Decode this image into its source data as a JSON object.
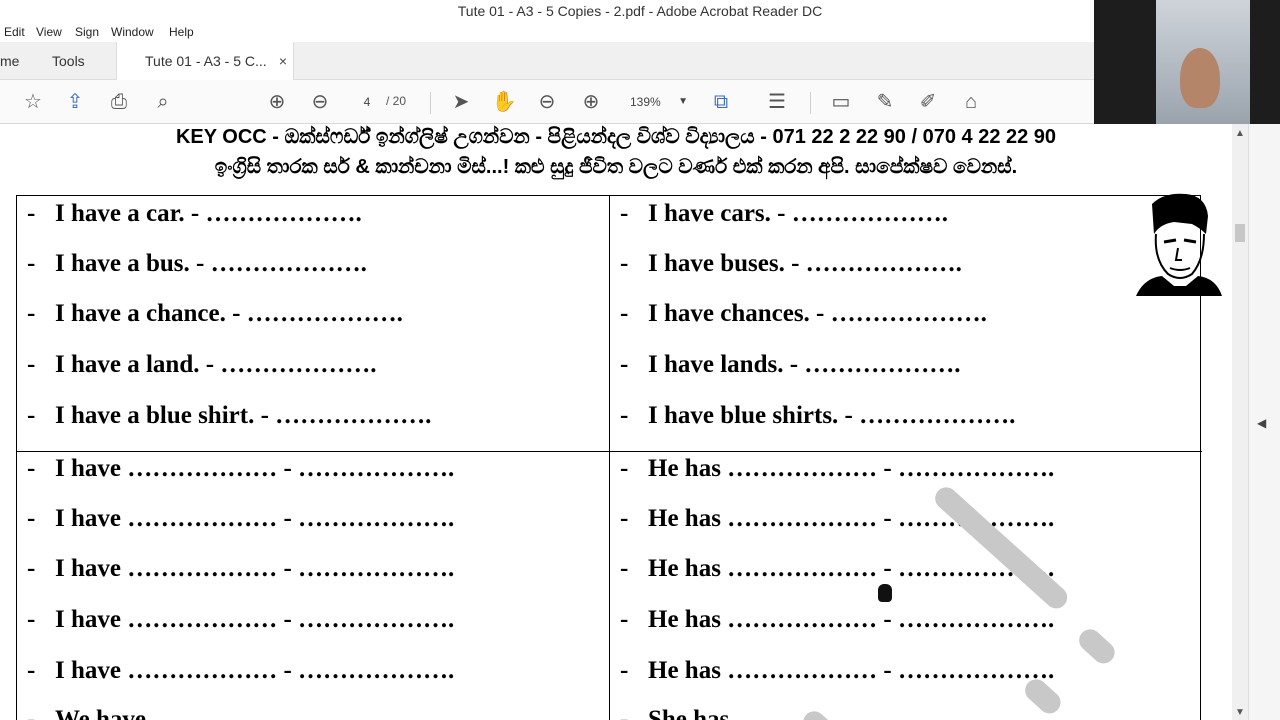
{
  "window": {
    "title": "Tute 01 - A3 - 5 Copies - 2.pdf - Adobe Acrobat Reader DC"
  },
  "menu": {
    "items": [
      "Edit",
      "View",
      "Sign",
      "Window",
      "Help"
    ]
  },
  "tabs": {
    "home": "me",
    "tools": "Tools",
    "doc": "Tute 01 - A3 - 5 C...",
    "close": "×"
  },
  "toolbar": {
    "page_current": "4",
    "page_total": "/ 20",
    "zoom": "139%"
  },
  "document": {
    "header1": "KEY OCC - ඔක්ස්ෆර්ඩ් ඉන්ග්ලිෂ් උගන්වන - පිළියන්දල විශ්ව විද්‍යාලය - 071 22 2 22 90 / 070 4 22 22 90",
    "header2": "ඉංග්‍රිසි තාරක සර් & කාන්චනා මිස්...! කළු සුදු ජීවිත වලට වර්ණ එක් කරන අපි. සාපේක්ෂව වෙනස්.",
    "dash": "-",
    "left_top": [
      "I have a car. - ……………….",
      "I have a bus. - ……………….",
      "I have a chance. - ……………….",
      "I have a land. - ……………….",
      "I have a blue shirt. - ………………."
    ],
    "right_top": [
      "I have cars. - ……………….",
      "I have buses. - ……………….",
      "I have chances. - ……………….",
      "I have lands. - ……………….",
      "I have blue shirts. - ………………."
    ],
    "left_bottom": [
      "I have ……………… - ……………….",
      "I have ……………… - ……………….",
      "I have ……………… - ……………….",
      "I have ……………… - ……………….",
      "I have ……………… - ……………….",
      "We have"
    ],
    "right_bottom": [
      "He has ……………… - ……………….",
      "He has ……………… - ……………….",
      "He has ……………… - ……………….",
      "He has ……………… - ……………….",
      "He has ……………… - ……………….",
      "She has"
    ]
  },
  "colors": {
    "accent": "#3a6fb6",
    "annotation": "#c8c8c8"
  },
  "icons": [
    "star-icon",
    "upload-icon",
    "print-icon",
    "zoom-search-icon",
    "arrow-up-icon",
    "arrow-down-icon",
    "select-cursor-icon",
    "hand-icon",
    "zoom-out-icon",
    "zoom-in-icon",
    "fit-page-icon",
    "scroll-mode-icon",
    "comment-icon",
    "highlight-icon",
    "draw-icon",
    "stamp-icon"
  ]
}
